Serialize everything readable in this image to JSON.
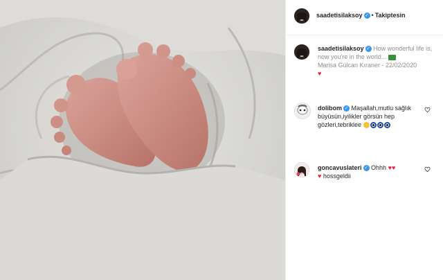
{
  "post": {
    "image_icon": "baby-feet-photo"
  },
  "header": {
    "username": "saadetisilaksoy",
    "separator": "•",
    "follow_label": "Takiptesin"
  },
  "caption": {
    "username": "saadetisilaksoy",
    "text": "How wonderful life is, now you're in the world...",
    "credit": "Marisa Gülcan Kıraner - 22/02/2020"
  },
  "comments": [
    {
      "username": "dolibom",
      "text": "Maşallah,mutlu sağlık büyüsün,iyilikler görsün hep gözleri,tebriklee"
    },
    {
      "username": "goncavuslateri",
      "text": "Ohhh",
      "text2": "hossgeldii"
    }
  ],
  "icons": {
    "verified": "verified-badge-icon",
    "like": "heart-outline-icon"
  },
  "colors": {
    "verified": "#3897f0",
    "heart": "#ed1a3b",
    "border": "#efefef"
  }
}
